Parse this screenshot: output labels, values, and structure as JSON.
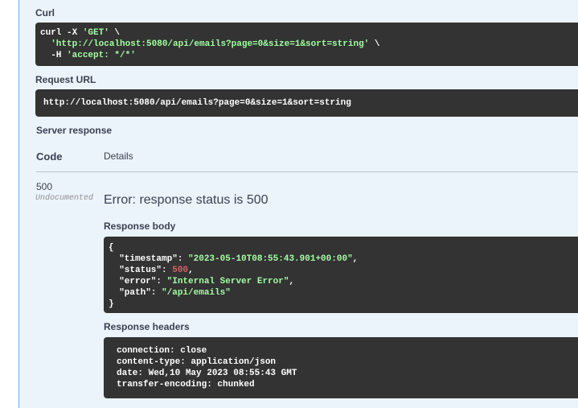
{
  "curl": {
    "label": "Curl",
    "cmd_line1_prefix": "curl -X ",
    "cmd_line1_method": "'GET'",
    "cmd_line1_suffix": " \\",
    "cmd_line2_url": "'http://localhost:5080/api/emails?page=0&size=1&sort=string'",
    "cmd_line2_suffix": " \\",
    "cmd_line3_prefix": "-H ",
    "cmd_line3_header": "'accept: */*'"
  },
  "request_url": {
    "label": "Request URL",
    "value": "http://localhost:5080/api/emails?page=0&size=1&sort=string"
  },
  "server_response": {
    "label": "Server response",
    "col_code": "Code",
    "col_details": "Details",
    "status_code": "500",
    "undocumented": "Undocumented",
    "error_title": "Error: response status is 500",
    "body_label": "Response body",
    "body": {
      "open": "{",
      "timestamp_key": "\"timestamp\"",
      "timestamp_val": "\"2023-05-10T08:55:43.901+00:00\"",
      "status_key": "\"status\"",
      "status_val": "500",
      "error_key": "\"error\"",
      "error_val": "\"Internal Server Error\"",
      "path_key": "\"path\"",
      "path_val": "\"/api/emails\"",
      "close": "}"
    },
    "headers_label": "Response headers",
    "headers": [
      "connection: close",
      "content-type: application/json",
      "date: Wed,10 May 2023 08:55:43 GMT",
      "transfer-encoding: chunked"
    ]
  },
  "colors": {
    "panel_bg": "#ebf3fb",
    "panel_border": "#61affe",
    "code_bg": "#333333",
    "string": "#a2fca2",
    "number": "#d36363"
  }
}
